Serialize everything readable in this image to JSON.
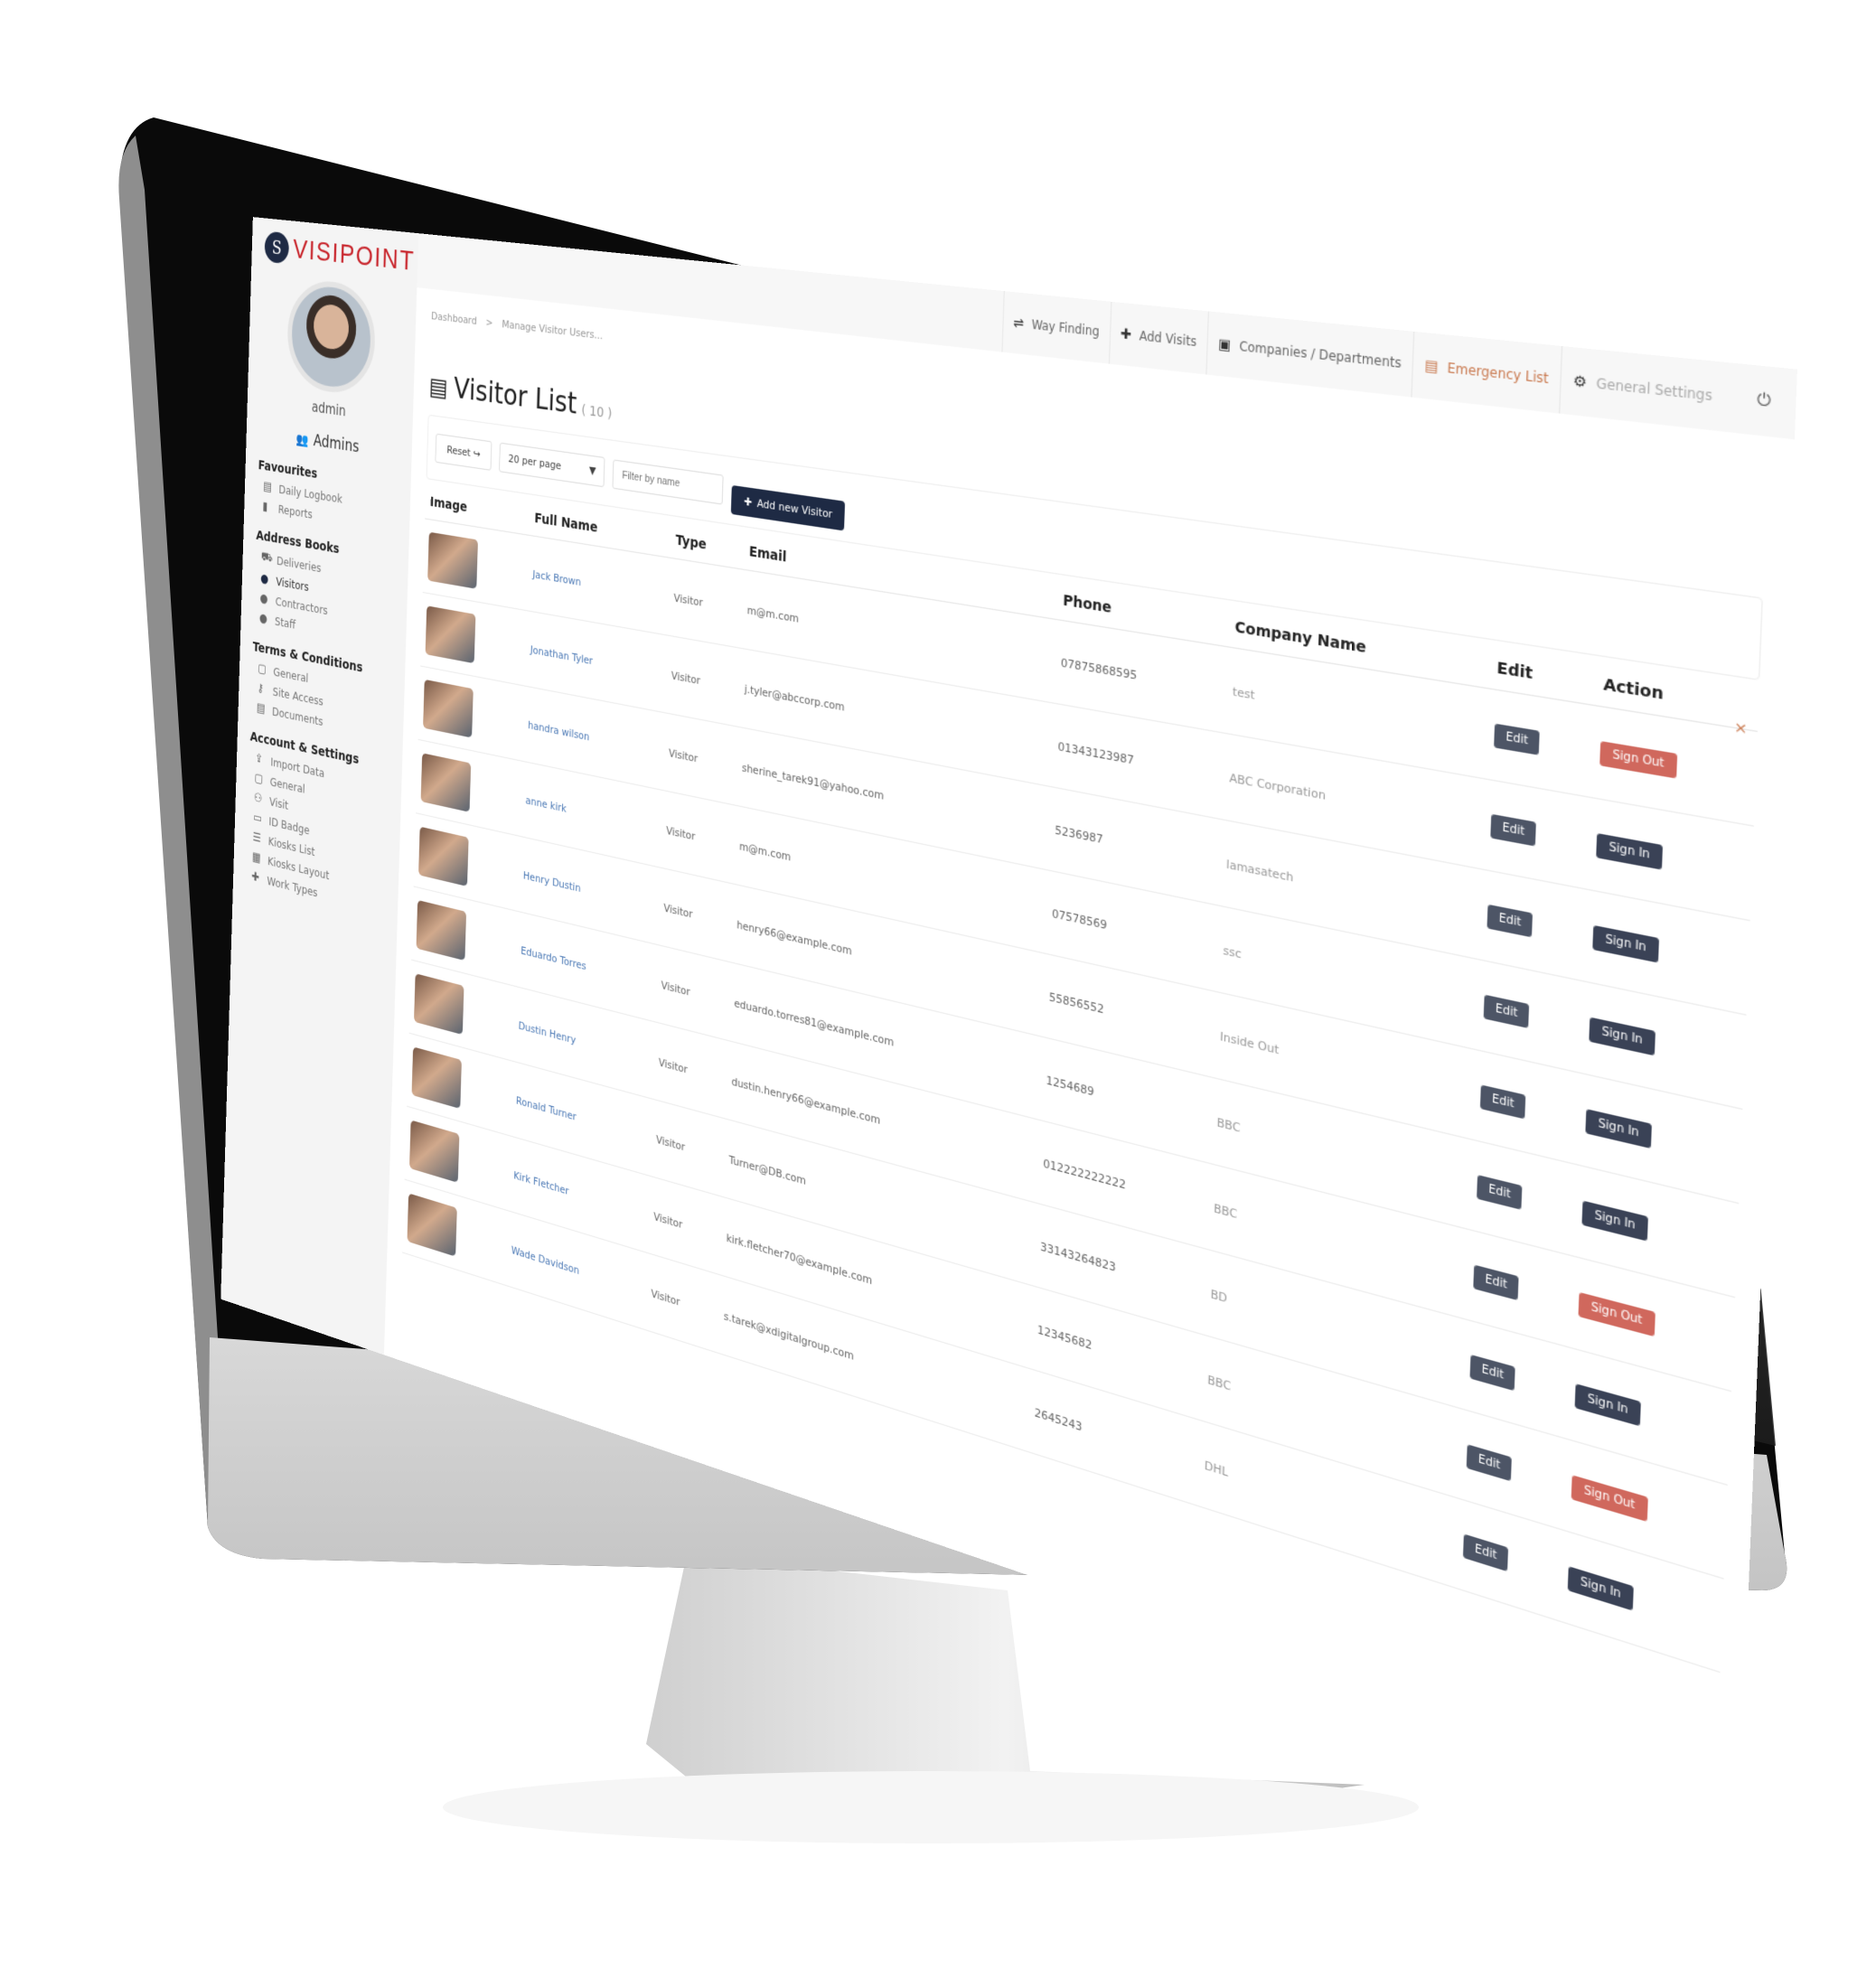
{
  "brand": {
    "name": "VISIPOINT",
    "mark_icon": "visipoint-logo-icon",
    "color": "#c8242b"
  },
  "user": {
    "name": "admin",
    "admins_label": "Admins"
  },
  "sidebar": {
    "sections": [
      {
        "title": "Favourites",
        "items": [
          {
            "label": "Daily Logbook",
            "icon": "logbook-icon",
            "glyph": "▤"
          },
          {
            "label": "Reports",
            "icon": "bar-chart-icon",
            "glyph": "▮"
          }
        ]
      },
      {
        "title": "Address Books",
        "items": [
          {
            "label": "Deliveries",
            "icon": "truck-icon",
            "glyph": "⛟"
          },
          {
            "label": "Visitors",
            "icon": "visitor-icon",
            "glyph": "●",
            "active": true
          },
          {
            "label": "Contractors",
            "icon": "contractor-icon",
            "glyph": "●"
          },
          {
            "label": "Staff",
            "icon": "staff-icon",
            "glyph": "●"
          }
        ]
      },
      {
        "title": "Terms & Conditions",
        "items": [
          {
            "label": "General",
            "icon": "clipboard-icon",
            "glyph": "▢"
          },
          {
            "label": "Site Access",
            "icon": "key-icon",
            "glyph": "⚷"
          },
          {
            "label": "Documents",
            "icon": "documents-icon",
            "glyph": "▤"
          }
        ]
      },
      {
        "title": "Account & Settings",
        "items": [
          {
            "label": "Import Data",
            "icon": "upload-icon",
            "glyph": "⇪"
          },
          {
            "label": "General",
            "icon": "clipboard-icon",
            "glyph": "▢"
          },
          {
            "label": "Visit",
            "icon": "people-icon",
            "glyph": "⚇"
          },
          {
            "label": "ID Badge",
            "icon": "id-badge-icon",
            "glyph": "▭"
          },
          {
            "label": "Kiosks List",
            "icon": "list-icon",
            "glyph": "☰"
          },
          {
            "label": "Kiosks Layout",
            "icon": "table-icon",
            "glyph": "▦"
          },
          {
            "label": "Work Types",
            "icon": "plug-icon",
            "glyph": "✚"
          }
        ]
      }
    ]
  },
  "topbar": {
    "items": [
      {
        "label": "Way Finding",
        "icon": "signpost-icon",
        "glyph": "⇌"
      },
      {
        "label": "Add Visits",
        "icon": "plus-icon",
        "glyph": "✚"
      },
      {
        "label": "Companies / Departments",
        "icon": "briefcase-icon",
        "glyph": "▣"
      },
      {
        "label": "Emergency List",
        "icon": "emergency-list-icon",
        "glyph": "▤"
      },
      {
        "label": "General Settings",
        "icon": "gear-icon",
        "glyph": "⚙"
      }
    ],
    "power_icon": "⏻"
  },
  "breadcrumb": {
    "items": [
      "Dashboard",
      "Manage Visitor Users..."
    ],
    "separator": ">"
  },
  "page": {
    "title": "Visitor List",
    "count": "( 10 )",
    "title_icon": "▤"
  },
  "filters": {
    "reset_label": "Reset",
    "reset_icon": "↪",
    "per_page": "20 per page",
    "dropdown_glyph": "▼",
    "filter_placeholder": "Filter by name",
    "add_label": "Add new Visitor",
    "add_icon": "✚",
    "close_glyph": "×"
  },
  "table": {
    "columns": [
      "Image",
      "Full Name",
      "Type",
      "Email",
      "Phone",
      "Company Name",
      "Edit",
      "Action"
    ],
    "rows": [
      {
        "name": "Jack Brown",
        "type": "Visitor",
        "email": "m@m.com",
        "phone": "07875868595",
        "company": "test",
        "edit": "Edit",
        "action": "Sign Out"
      },
      {
        "name": "Jonathan Tyler",
        "type": "Visitor",
        "email": "j.tyler@abccorp.com",
        "phone": "01343123987",
        "company": "ABC Corporation",
        "edit": "Edit",
        "action": "Sign In"
      },
      {
        "name": "handra wilson",
        "type": "Visitor",
        "email": "sherine_tarek91@yahoo.com",
        "phone": "5236987",
        "company": "lamasatech",
        "edit": "Edit",
        "action": "Sign In"
      },
      {
        "name": "anne kirk",
        "type": "Visitor",
        "email": "m@m.com",
        "phone": "07578569",
        "company": "ssc",
        "edit": "Edit",
        "action": "Sign In"
      },
      {
        "name": "Henry Dustin",
        "type": "Visitor",
        "email": "henry66@example.com",
        "phone": "55856552",
        "company": "Inside Out",
        "edit": "Edit",
        "action": "Sign In"
      },
      {
        "name": "Eduardo Torres",
        "type": "Visitor",
        "email": "eduardo.torres81@example.com",
        "phone": "1254689",
        "company": "BBC",
        "edit": "Edit",
        "action": "Sign In"
      },
      {
        "name": "Dustin Henry",
        "type": "Visitor",
        "email": "dustin.henry66@example.com",
        "phone": "012222222222",
        "company": "BBC",
        "edit": "Edit",
        "action": "Sign Out"
      },
      {
        "name": "Ronald Turner",
        "type": "Visitor",
        "email": "Turner@DB.com",
        "phone": "33143264823",
        "company": "BD",
        "edit": "Edit",
        "action": "Sign In"
      },
      {
        "name": "Kirk Fletcher",
        "type": "Visitor",
        "email": "kirk.fletcher70@example.com",
        "phone": "12345682",
        "company": "BBC",
        "edit": "Edit",
        "action": "Sign Out"
      },
      {
        "name": "Wade Davidson",
        "type": "Visitor",
        "email": "s.tarek@xdigitalgroup.com",
        "phone": "2645243",
        "company": "DHL",
        "edit": "Edit",
        "action": "Sign In"
      }
    ]
  },
  "colors": {
    "navy": "#1e2a44",
    "sign_out": "#d0685d",
    "link": "#4a78b5",
    "emergency": "#c9794f"
  }
}
